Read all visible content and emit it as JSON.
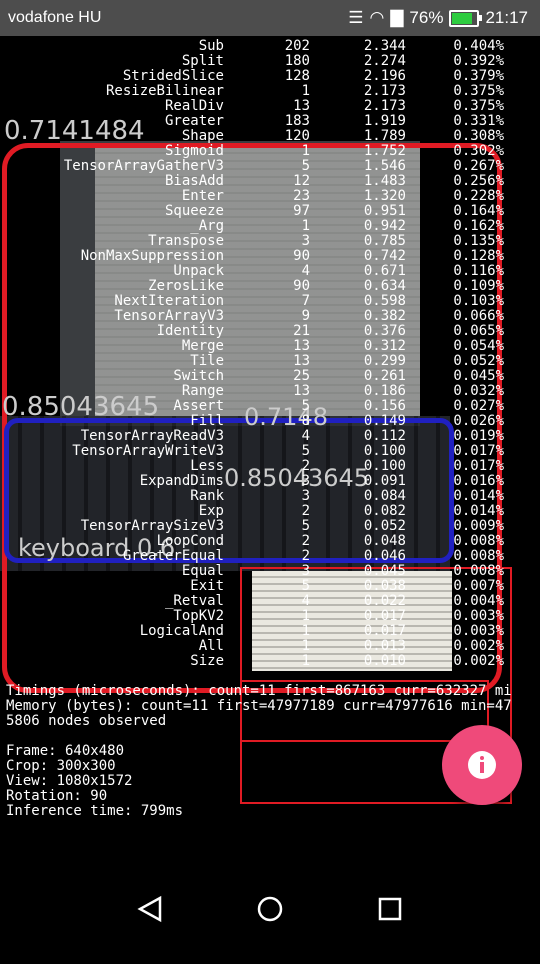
{
  "status_bar": {
    "carrier": "vodafone HU",
    "battery": "76%",
    "battery_level": 0.76,
    "time": "21:17"
  },
  "detections": [
    {
      "label": "0.7141484",
      "color": "#e01b24"
    },
    {
      "label": "0.85043645",
      "color": "#2222cc"
    },
    {
      "label": "0.7148",
      "color": "#2222cc"
    },
    {
      "label": "0.85043645",
      "color": "#2222cc"
    },
    {
      "label": "keyboard 0.6",
      "color": "#2222cc"
    }
  ],
  "box_colors": {
    "red": "#e01b24",
    "blue": "#2020c0"
  },
  "stats_rows": [
    [
      "Sub",
      "202",
      "2.344",
      "0.404%"
    ],
    [
      "Split",
      "180",
      "2.274",
      "0.392%"
    ],
    [
      "StridedSlice",
      "128",
      "2.196",
      "0.379%"
    ],
    [
      "ResizeBilinear",
      "1",
      "2.173",
      "0.375%"
    ],
    [
      "RealDiv",
      "13",
      "2.173",
      "0.375%"
    ],
    [
      "Greater",
      "183",
      "1.919",
      "0.331%"
    ],
    [
      "Shape",
      "120",
      "1.789",
      "0.308%"
    ],
    [
      "Sigmoid",
      "1",
      "1.752",
      "0.302%"
    ],
    [
      "TensorArrayGatherV3",
      "5",
      "1.546",
      "0.267%"
    ],
    [
      "BiasAdd",
      "12",
      "1.483",
      "0.256%"
    ],
    [
      "Enter",
      "23",
      "1.320",
      "0.228%"
    ],
    [
      "Squeeze",
      "97",
      "0.951",
      "0.164%"
    ],
    [
      "_Arg",
      "1",
      "0.942",
      "0.162%"
    ],
    [
      "Transpose",
      "3",
      "0.785",
      "0.135%"
    ],
    [
      "NonMaxSuppression",
      "90",
      "0.742",
      "0.128%"
    ],
    [
      "Unpack",
      "4",
      "0.671",
      "0.116%"
    ],
    [
      "ZerosLike",
      "90",
      "0.634",
      "0.109%"
    ],
    [
      "NextIteration",
      "7",
      "0.598",
      "0.103%"
    ],
    [
      "TensorArrayV3",
      "9",
      "0.382",
      "0.066%"
    ],
    [
      "Identity",
      "21",
      "0.376",
      "0.065%"
    ],
    [
      "Merge",
      "13",
      "0.312",
      "0.054%"
    ],
    [
      "Tile",
      "13",
      "0.299",
      "0.052%"
    ],
    [
      "Switch",
      "25",
      "0.261",
      "0.045%"
    ],
    [
      "Range",
      "13",
      "0.186",
      "0.032%"
    ],
    [
      "Assert",
      "5",
      "0.156",
      "0.027%"
    ],
    [
      "Fill",
      "8",
      "0.149",
      "0.026%"
    ],
    [
      "TensorArrayReadV3",
      "4",
      "0.112",
      "0.019%"
    ],
    [
      "TensorArrayWriteV3",
      "5",
      "0.100",
      "0.017%"
    ],
    [
      "Less",
      "2",
      "0.100",
      "0.017%"
    ],
    [
      "ExpandDims",
      "3",
      "0.091",
      "0.016%"
    ],
    [
      "Rank",
      "3",
      "0.084",
      "0.014%"
    ],
    [
      "Exp",
      "2",
      "0.082",
      "0.014%"
    ],
    [
      "TensorArraySizeV3",
      "5",
      "0.052",
      "0.009%"
    ],
    [
      "LoopCond",
      "2",
      "0.048",
      "0.008%"
    ],
    [
      "GreaterEqual",
      "2",
      "0.046",
      "0.008%"
    ],
    [
      "Equal",
      "3",
      "0.045",
      "0.008%"
    ],
    [
      "Exit",
      "5",
      "0.038",
      "0.007%"
    ],
    [
      "_Retval",
      "4",
      "0.022",
      "0.004%"
    ],
    [
      "TopKV2",
      "1",
      "0.017",
      "0.003%"
    ],
    [
      "LogicalAnd",
      "1",
      "0.017",
      "0.003%"
    ],
    [
      "All",
      "1",
      "0.013",
      "0.002%"
    ],
    [
      "Size",
      "1",
      "0.010",
      "0.002%"
    ]
  ],
  "info": {
    "timings": "Timings (microseconds): count=11 first=867163 curr=632327 mi",
    "memory": "Memory (bytes): count=11 first=47977189 curr=47977616 min=47",
    "nodes": "5806 nodes observed",
    "frame": "Frame: 640x480",
    "crop": "Crop: 300x300",
    "view": "View: 1080x1572",
    "rotation": "Rotation: 90",
    "inference": "Inference time: 799ms"
  }
}
